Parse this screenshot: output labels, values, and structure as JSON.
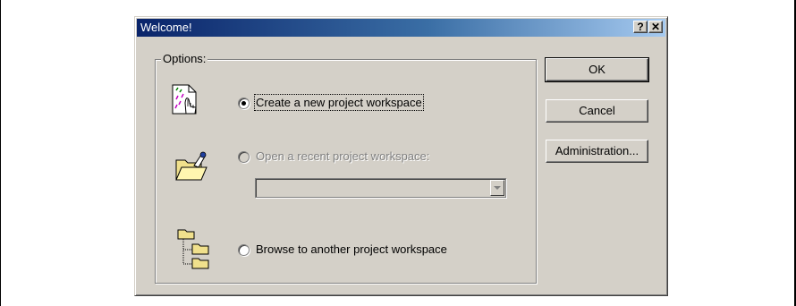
{
  "window": {
    "title": "Welcome!"
  },
  "titlebar": {
    "help_label": "?",
    "close_label": "✕"
  },
  "options": {
    "group_label": "Options:",
    "items": [
      {
        "label": "Create a new project workspace",
        "selected": true,
        "enabled": true,
        "icon": "new-workspace-icon"
      },
      {
        "label": "Open a recent project workspace:",
        "selected": false,
        "enabled": false,
        "icon": "open-folder-icon"
      },
      {
        "label": "Browse to another project workspace",
        "selected": false,
        "enabled": true,
        "icon": "folder-tree-icon"
      }
    ],
    "recent_combo": {
      "value": "",
      "enabled": false
    }
  },
  "buttons": {
    "ok": "OK",
    "cancel": "Cancel",
    "administration": "Administration..."
  },
  "colors": {
    "dialog_face": "#d4d0c8",
    "title_start": "#0a246a",
    "title_end": "#a6caf0"
  }
}
